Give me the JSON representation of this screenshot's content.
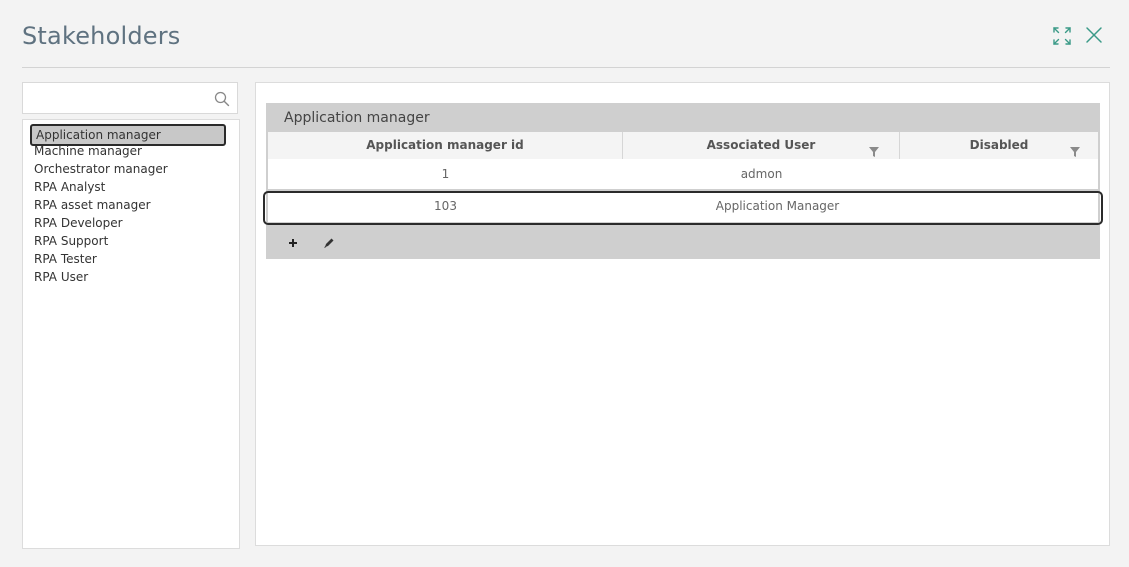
{
  "dialog": {
    "title": "Stakeholders"
  },
  "icons": {
    "maximize": "maximize-icon",
    "close": "close-icon",
    "search": "search-icon",
    "filter": "filter-icon",
    "add": "plus-icon",
    "edit": "pencil-icon"
  },
  "search": {
    "value": "",
    "placeholder": ""
  },
  "roles": {
    "items": [
      {
        "label": "Application manager",
        "selected": true
      },
      {
        "label": "Machine manager",
        "selected": false
      },
      {
        "label": "Orchestrator manager",
        "selected": false
      },
      {
        "label": "RPA Analyst",
        "selected": false
      },
      {
        "label": "RPA asset manager",
        "selected": false
      },
      {
        "label": "RPA Developer",
        "selected": false
      },
      {
        "label": "RPA Support",
        "selected": false
      },
      {
        "label": "RPA Tester",
        "selected": false
      },
      {
        "label": "RPA User",
        "selected": false
      }
    ]
  },
  "grid": {
    "title": "Application manager",
    "columns": [
      "Application manager id",
      "Associated User",
      "Disabled"
    ],
    "rows": [
      {
        "id": "1",
        "user": "admon",
        "disabled": ""
      },
      {
        "id": "103",
        "user": "Application Manager",
        "disabled": ""
      }
    ]
  },
  "colors": {
    "accent": "#2e8b7a",
    "title": "#5f7280",
    "grid_header": "#cfcfcf",
    "selection_border": "#2b2b2b"
  }
}
